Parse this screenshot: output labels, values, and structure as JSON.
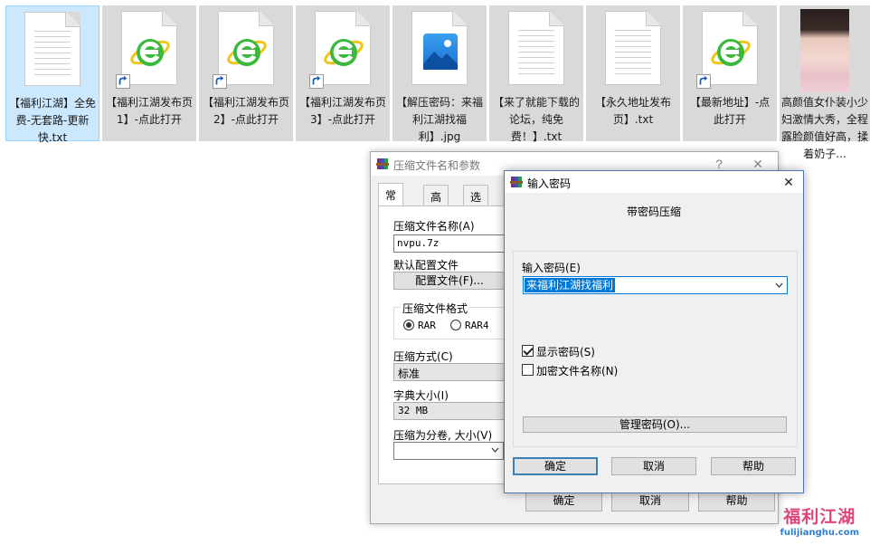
{
  "files": [
    {
      "name": "【福利江湖】全免费-无套路-更新快.txt",
      "type": "txt",
      "shortcut": false,
      "selected": true
    },
    {
      "name": "【福利江湖发布页1】-点此打开",
      "type": "ie",
      "shortcut": true,
      "selected": false
    },
    {
      "name": "【福利江湖发布页2】-点此打开",
      "type": "ie",
      "shortcut": true,
      "selected": false
    },
    {
      "name": "【福利江湖发布页3】-点此打开",
      "type": "ie",
      "shortcut": true,
      "selected": false
    },
    {
      "name": "【解压密码：来福利江湖找福利】.jpg",
      "type": "jpg",
      "shortcut": false,
      "selected": false
    },
    {
      "name": "【来了就能下载的论坛，纯免费！】.txt",
      "type": "txt",
      "shortcut": false,
      "selected": false
    },
    {
      "name": "【永久地址发布页】.txt",
      "type": "txt",
      "shortcut": false,
      "selected": false
    },
    {
      "name": "【最新地址】-点此打开",
      "type": "ie",
      "shortcut": true,
      "selected": false
    },
    {
      "name": "高颜值女仆装小少妇激情大秀，全程露脸颜值好高，揉着奶子...",
      "type": "photo",
      "shortcut": false,
      "selected": false
    }
  ],
  "archive_dialog": {
    "title": "压缩文件名和参数",
    "help_glyph": "?",
    "close_glyph": "✕",
    "tabs": [
      "常规",
      "高级",
      "选项"
    ],
    "archive_name_label": "压缩文件名称(A)",
    "archive_name_value": "nvpu.7z",
    "default_profile_label": "默认配置文件",
    "profiles_button": "配置文件(F)...",
    "format_group_label": "压缩文件格式",
    "format_options": [
      "RAR",
      "RAR4"
    ],
    "format_selected": "RAR",
    "method_label": "压缩方式(C)",
    "method_value": "标准",
    "dict_label": "字典大小(I)",
    "dict_value": "32 MB",
    "split_label": "压缩为分卷, 大小(V)",
    "split_value": "",
    "ok_button": "确定",
    "cancel_button": "取消",
    "help_button": "帮助"
  },
  "password_dialog": {
    "title": "输入密码",
    "close_glyph": "✕",
    "heading": "带密码压缩",
    "password_label": "输入密码(E)",
    "password_value": "来福利江湖找福利",
    "show_password_label": "显示密码(S)",
    "show_password_checked": true,
    "encrypt_names_label": "加密文件名称(N)",
    "encrypt_names_checked": false,
    "organize_button": "管理密码(O)...",
    "ok_button": "确定",
    "cancel_button": "取消",
    "help_button": "帮助"
  },
  "watermark": {
    "logo": "福利江湖",
    "url": "fulijianghu.com"
  },
  "colors": {
    "accent": "#0078d7",
    "ie_green": "#3cb83c",
    "selected_tile": "#cce8ff",
    "watermark_pink": "#e0457a",
    "watermark_blue": "#2e7fd0"
  },
  "icons": {
    "txt": "text-document-icon",
    "ie": "internet-explorer-icon",
    "jpg": "image-file-icon",
    "winrar": "winrar-books-icon"
  }
}
